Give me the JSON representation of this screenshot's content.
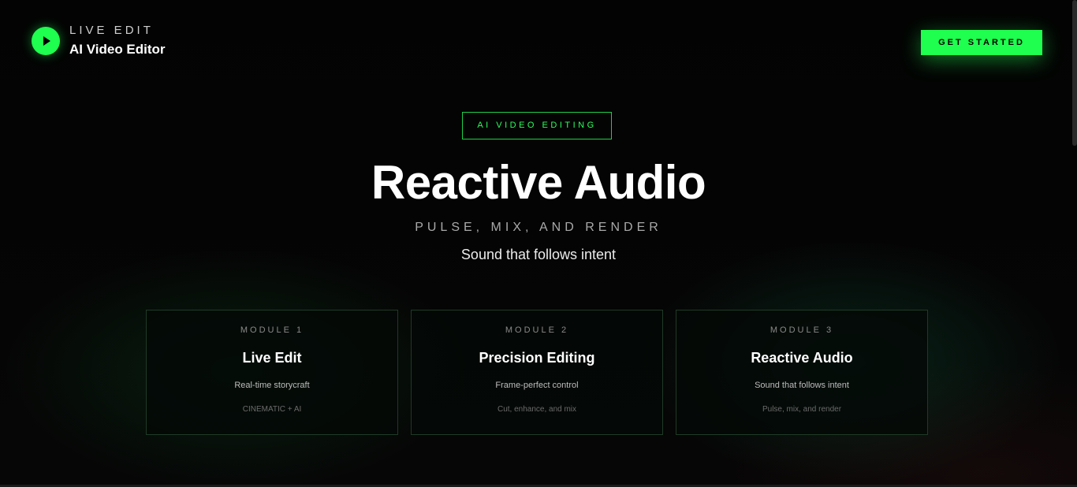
{
  "header": {
    "logo_icon": "play-icon",
    "kicker": "LIVE EDIT",
    "brand": "AI Video Editor",
    "cta_label": "GET STARTED"
  },
  "hero": {
    "badge": "AI VIDEO EDITING",
    "title": "Reactive Audio",
    "subtitle": "PULSE, MIX, AND RENDER",
    "tagline": "Sound that follows intent"
  },
  "modules": [
    {
      "label": "MODULE 1",
      "title": "Live Edit",
      "description": "Real-time storycraft",
      "note": "CINEMATIC + AI"
    },
    {
      "label": "MODULE 2",
      "title": "Precision Editing",
      "description": "Frame-perfect control",
      "note": "Cut, enhance, and mix"
    },
    {
      "label": "MODULE 3",
      "title": "Reactive Audio",
      "description": "Sound that follows intent",
      "note": "Pulse, mix, and render"
    }
  ],
  "colors": {
    "accent": "#1fff4f",
    "background": "#020202"
  }
}
